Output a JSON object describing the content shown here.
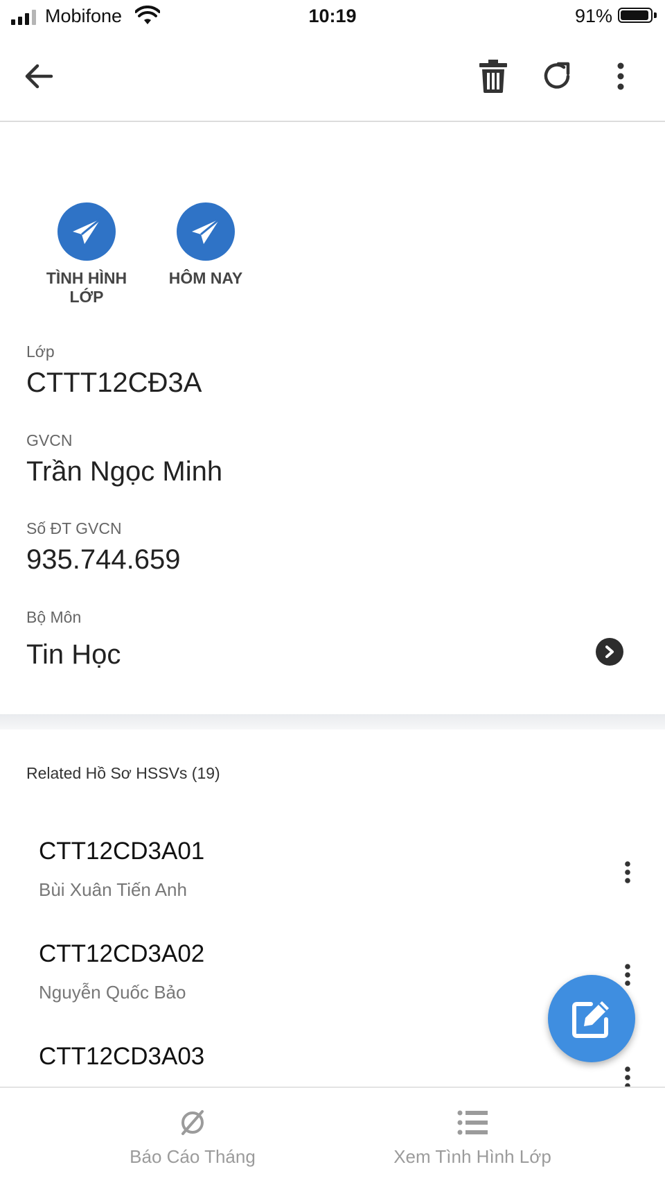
{
  "status_bar": {
    "carrier": "Mobifone",
    "time": "10:19",
    "battery_percent": "91%",
    "battery_level": 0.91,
    "signal_bars": 3
  },
  "app_bar": {
    "back_icon": "arrow-left-icon",
    "actions": [
      "trash-icon",
      "refresh-icon",
      "more-vertical-icon"
    ]
  },
  "quick_actions": [
    {
      "icon": "paper-plane-icon",
      "label": "TÌNH HÌNH LỚP"
    },
    {
      "icon": "paper-plane-icon",
      "label": "HÔM NAY"
    }
  ],
  "details": {
    "class_label": "Lớp",
    "class_value": "CTTT12CĐ3A",
    "teacher_label": "GVCN",
    "teacher_value": "Trần Ngọc Minh",
    "phone_label": "Số ĐT GVCN",
    "phone_value": "935.744.659",
    "department_label": "Bộ Môn",
    "department_value": "Tin Học"
  },
  "related": {
    "header": "Related Hồ Sơ HSSVs (19)",
    "items": [
      {
        "code": "CTT12CD3A01",
        "name": "Bùi Xuân Tiến Anh"
      },
      {
        "code": "CTT12CD3A02",
        "name": "Nguyễn Quốc Bảo"
      },
      {
        "code": "CTT12CD3A03",
        "name": ""
      }
    ]
  },
  "bottom_nav": [
    {
      "icon": "empty-set-icon",
      "label": "Báo Cáo Tháng"
    },
    {
      "icon": "list-icon",
      "label": "Xem Tình Hình Lớp"
    }
  ],
  "colors": {
    "accent": "#2f73c6",
    "fab": "#3f8ee0",
    "muted_text": "#9b9b9b"
  }
}
